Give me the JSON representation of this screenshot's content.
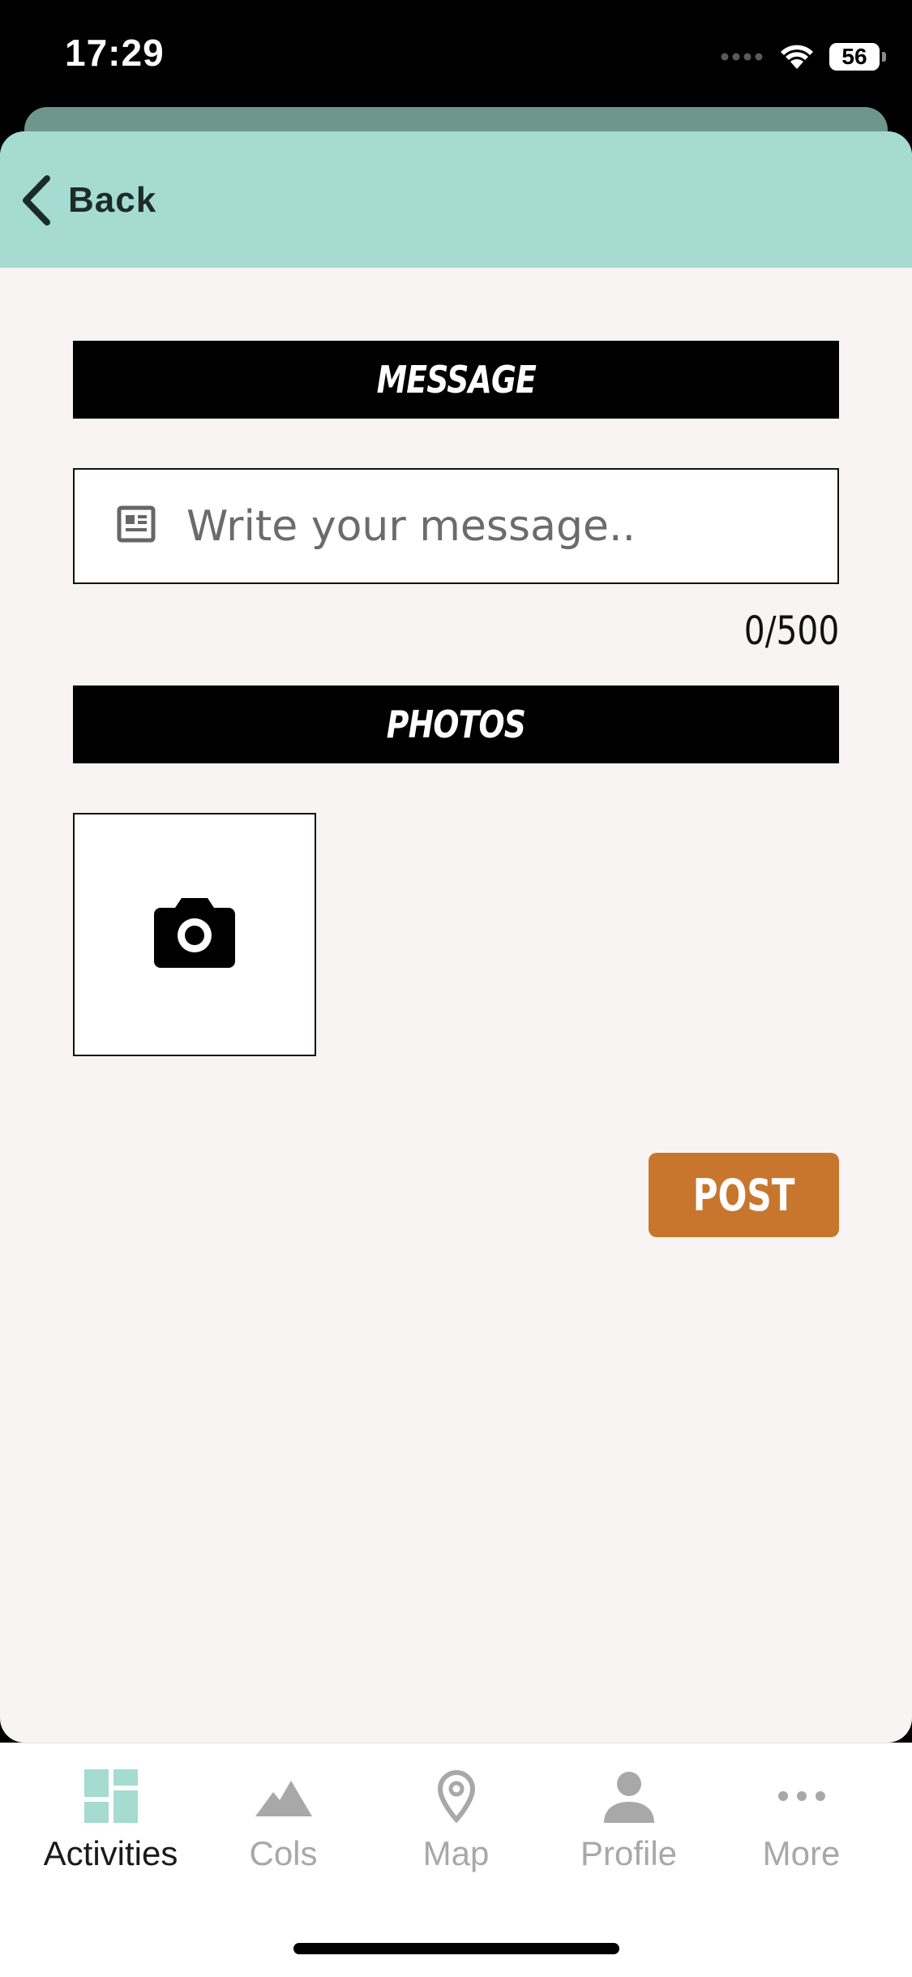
{
  "status_bar": {
    "time": "17:29",
    "battery": "56"
  },
  "header": {
    "back_label": "Back"
  },
  "message_section": {
    "title": "MESSAGE",
    "placeholder": "Write your message..",
    "value": "",
    "counter": "0/500"
  },
  "photos_section": {
    "title": "PHOTOS"
  },
  "post_button": {
    "label": "POST",
    "color": "#c8762d"
  },
  "tab_bar": {
    "items": [
      {
        "label": "Activities",
        "icon": "dashboard-icon",
        "active": true
      },
      {
        "label": "Cols",
        "icon": "mountain-icon",
        "active": false
      },
      {
        "label": "Map",
        "icon": "map-pin-icon",
        "active": false
      },
      {
        "label": "Profile",
        "icon": "person-icon",
        "active": false
      },
      {
        "label": "More",
        "icon": "more-dots-icon",
        "active": false
      }
    ]
  },
  "colors": {
    "header": "#a5dbd0",
    "background": "#f7f4f3",
    "accent": "#c8762d",
    "active_tab_icon": "#a5dbd0",
    "inactive_tab": "#a8a8a8"
  }
}
